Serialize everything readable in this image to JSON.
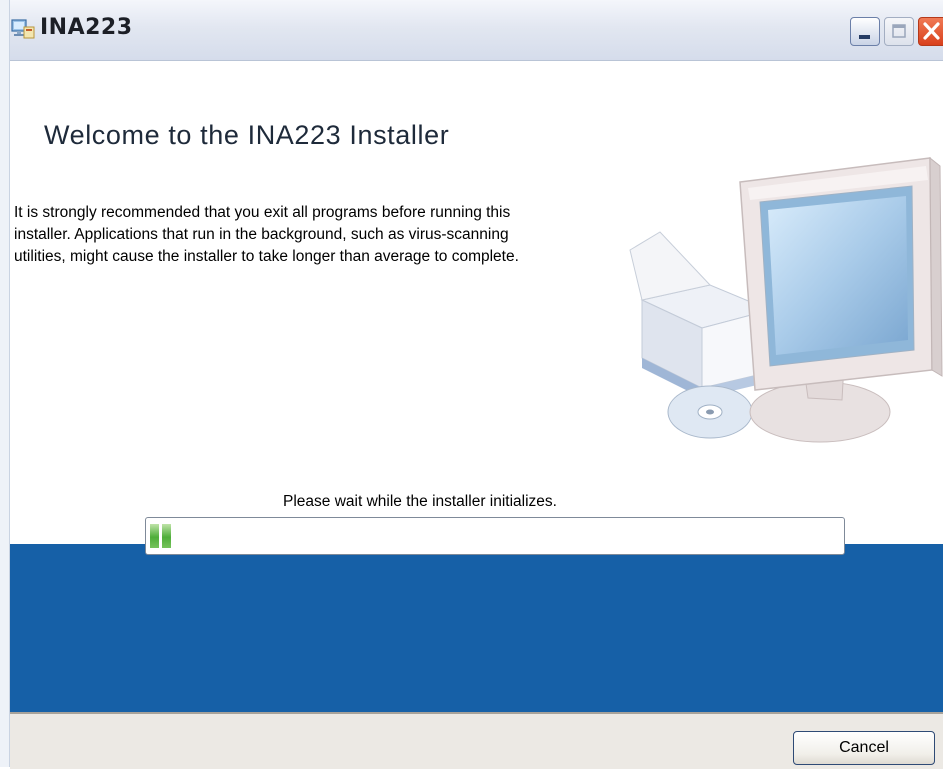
{
  "window": {
    "title": "INA223"
  },
  "installer": {
    "heading": "Welcome to the INA223 Installer",
    "intro_lines": [
      "It is strongly recommended that you exit all programs before running this",
      "installer. Applications that run in the background, such as virus-scanning",
      "utilities, might cause the installer to take longer than average to complete."
    ],
    "status_text": "Please wait while the installer initializes.",
    "progress_fraction": 0.03
  },
  "footer": {
    "cancel_label": "Cancel"
  },
  "icons": {
    "app": "installer-app-icon",
    "minimize": "minimize-icon",
    "maximize": "maximize-icon",
    "close": "close-icon",
    "illustration": "computer-installation-illustration"
  },
  "colors": {
    "band_blue": "#1660a7",
    "progress_green": "#4fae3a",
    "close_red": "#d9401c"
  }
}
